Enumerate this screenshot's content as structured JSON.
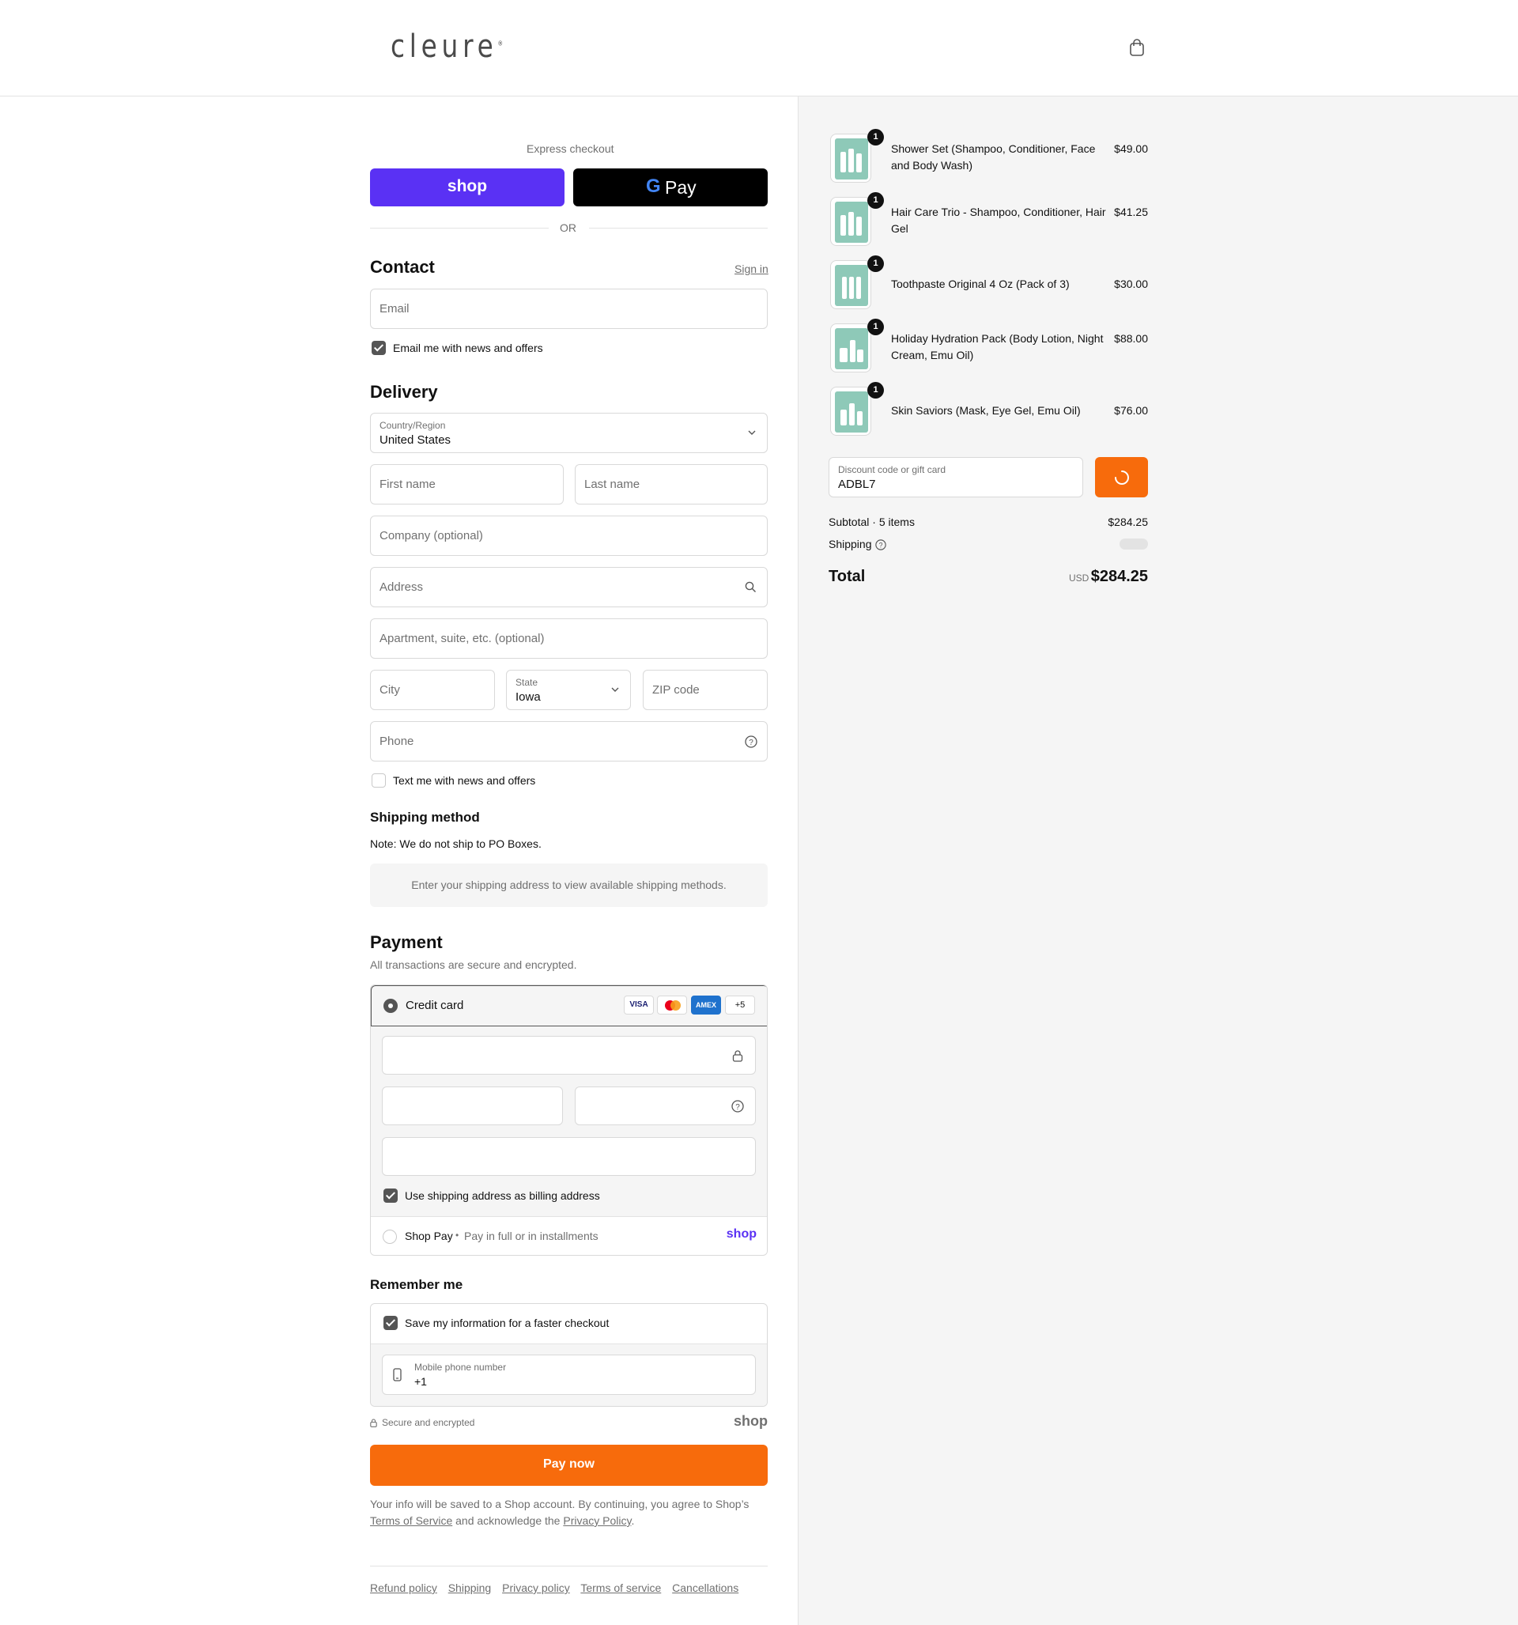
{
  "brand": {
    "logo": "cleure",
    "logo_mark": "®"
  },
  "express": {
    "title": "Express checkout",
    "shop_label": "shop",
    "gpay_label": "Pay",
    "or_label": "OR"
  },
  "contact": {
    "title": "Contact",
    "sign_in": "Sign in",
    "email_placeholder": "Email",
    "newsletter_label": "Email me with news and offers"
  },
  "delivery": {
    "title": "Delivery",
    "country_label": "Country/Region",
    "country_value": "United States",
    "first_name": "First name",
    "last_name": "Last name",
    "company": "Company (optional)",
    "address": "Address",
    "apartment": "Apartment, suite, etc. (optional)",
    "city": "City",
    "state_label": "State",
    "state_value": "Iowa",
    "zip": "ZIP code",
    "phone": "Phone",
    "sms_label": "Text me with news and offers"
  },
  "shipping_method": {
    "title": "Shipping method",
    "note": "Note: We do not ship to PO Boxes.",
    "placeholder": "Enter your shipping address to view available shipping methods."
  },
  "payment": {
    "title": "Payment",
    "subtitle": "All transactions are secure and encrypted.",
    "credit_card_label": "Credit card",
    "card_brands": [
      "VISA",
      "",
      "AMEX",
      "+5"
    ],
    "billing_label": "Use shipping address as billing address",
    "shop_pay_label": "Shop Pay",
    "shop_pay_sep": "•",
    "shop_pay_desc": "Pay in full or in installments",
    "shop_pay_logo": "shop"
  },
  "remember": {
    "title": "Remember me",
    "save_label": "Save my information for a faster checkout",
    "mobile_label": "Mobile phone number",
    "mobile_value": "+1"
  },
  "secure": {
    "label": "Secure and encrypted",
    "shop_logo": "shop"
  },
  "pay_now": "Pay now",
  "legal": {
    "text_1": "Your info will be saved to a Shop account. By continuing, you agree to Shop’s",
    "tos": "Terms of Service",
    "text_2": "and acknowledge the",
    "privacy": "Privacy Policy",
    "text_3": "."
  },
  "footer_links": [
    "Refund policy",
    "Shipping",
    "Privacy policy",
    "Terms of service",
    "Cancellations"
  ],
  "cart": {
    "items": [
      {
        "name": "Shower Set (Shampoo, Conditioner, Face and Body Wash)",
        "price": "$49.00",
        "qty": "1"
      },
      {
        "name": "Hair Care Trio - Shampoo, Conditioner, Hair Gel",
        "price": "$41.25",
        "qty": "1"
      },
      {
        "name": "Toothpaste Original 4 Oz (Pack of 3)",
        "price": "$30.00",
        "qty": "1"
      },
      {
        "name": "Holiday Hydration Pack (Body Lotion, Night Cream, Emu Oil)",
        "price": "$88.00",
        "qty": "1"
      },
      {
        "name": "Skin Saviors (Mask, Eye Gel, Emu Oil)",
        "price": "$76.00",
        "qty": "1"
      }
    ],
    "discount_label": "Discount code or gift card",
    "discount_value": "ADBL7",
    "subtotal_label": "Subtotal · 5 items",
    "subtotal_value": "$284.25",
    "shipping_label": "Shipping",
    "total_label": "Total",
    "total_currency": "USD",
    "total_value": "$284.25"
  }
}
